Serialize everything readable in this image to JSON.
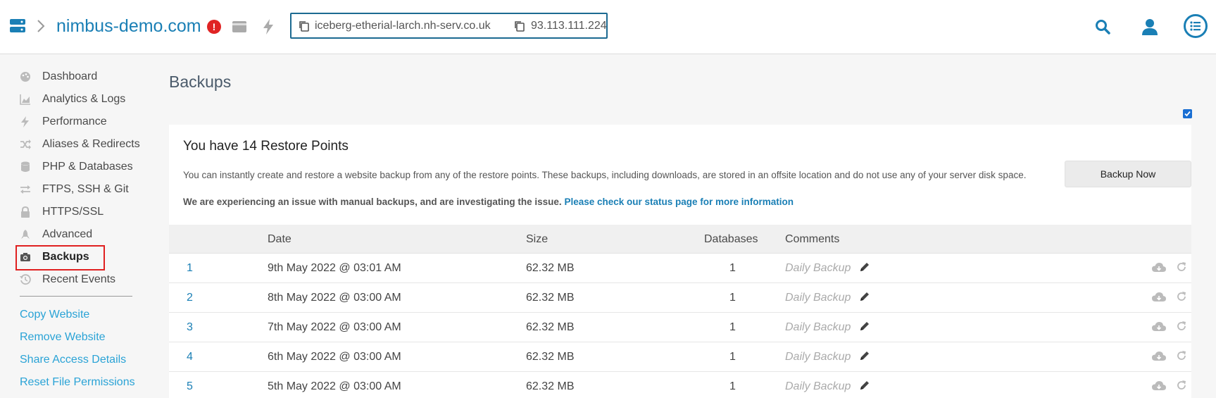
{
  "header": {
    "domain": "nimbus-demo.com",
    "alert_count": "!",
    "hostname": "iceberg-etherial-larch.nh-serv.co.uk",
    "ip": "93.113.111.224",
    "icons": [
      "server-icon",
      "chevron-right-icon",
      "alert-icon",
      "card-icon",
      "bolt-icon",
      "copy-icon",
      "search-icon",
      "user-icon",
      "list-icon"
    ]
  },
  "sidebar": {
    "items": [
      {
        "label": "Dashboard",
        "icon": "palette-icon"
      },
      {
        "label": "Analytics & Logs",
        "icon": "area-chart-icon"
      },
      {
        "label": "Performance",
        "icon": "bolt-icon"
      },
      {
        "label": "Aliases & Redirects",
        "icon": "shuffle-icon"
      },
      {
        "label": "PHP & Databases",
        "icon": "database-icon"
      },
      {
        "label": "FTPS, SSH & Git",
        "icon": "exchange-icon"
      },
      {
        "label": "HTTPS/SSL",
        "icon": "lock-icon"
      },
      {
        "label": "Advanced",
        "icon": "rocket-icon"
      },
      {
        "label": "Backups",
        "icon": "camera-icon",
        "active": true
      },
      {
        "label": "Recent Events",
        "icon": "history-icon"
      }
    ],
    "links": [
      "Copy Website",
      "Remove Website",
      "Share Access Details",
      "Reset File Permissions"
    ]
  },
  "main": {
    "title": "Backups",
    "card": {
      "title": "You have 14 Restore Points",
      "description": "You can instantly create and restore a website backup from any of the restore points. These backups, including downloads, are stored in an offsite location and do not use any of your server disk space.",
      "warning": "We are experiencing an issue with manual backups, and are investigating the issue.",
      "warning_link": "Please check our status page for more information",
      "button": "Backup Now"
    },
    "table": {
      "columns": [
        "Date",
        "Size",
        "Databases",
        "Comments"
      ],
      "rows": [
        {
          "num": "1",
          "date": "9th May 2022 @ 03:01 AM",
          "size": "62.32 MB",
          "databases": "1",
          "comment": "Daily Backup"
        },
        {
          "num": "2",
          "date": "8th May 2022 @ 03:00 AM",
          "size": "62.32 MB",
          "databases": "1",
          "comment": "Daily Backup"
        },
        {
          "num": "3",
          "date": "7th May 2022 @ 03:00 AM",
          "size": "62.32 MB",
          "databases": "1",
          "comment": "Daily Backup"
        },
        {
          "num": "4",
          "date": "6th May 2022 @ 03:00 AM",
          "size": "62.32 MB",
          "databases": "1",
          "comment": "Daily Backup"
        },
        {
          "num": "5",
          "date": "5th May 2022 @ 03:00 AM",
          "size": "62.32 MB",
          "databases": "1",
          "comment": "Daily Backup"
        }
      ]
    }
  },
  "colors": {
    "accent": "#1a7fb5",
    "link": "#2aa3d6",
    "alert": "#e02424"
  }
}
